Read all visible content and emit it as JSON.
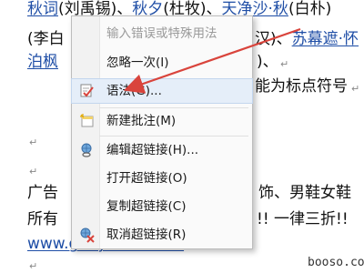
{
  "document": {
    "line1": {
      "seg1": "秋词",
      "seg2": "(刘禹锡)、",
      "seg3": "秋夕",
      "seg4": "(杜牧)、",
      "seg5": "天净沙·秋",
      "seg6": "(白朴)"
    },
    "line2": {
      "left": "(李白",
      "mid": "汉)、",
      "right": "苏幕遮·怀"
    },
    "line3": {
      "left": "泊枫",
      "right": ")、"
    },
    "line4": {
      "right": "能为标点符号"
    },
    "line5": {
      "left": "广告",
      "right": "饰、男鞋女鞋"
    },
    "line6": {
      "left": "所有",
      "right": "!! 一律三折!!"
    },
    "line7": {
      "url": "www.gouyuhan.com"
    },
    "para_mark": "↵"
  },
  "context_menu": {
    "items": [
      {
        "label": "输入错误或特殊用法",
        "icon": "none",
        "enabled": false
      },
      {
        "label": "忽略一次(I)",
        "icon": "none",
        "enabled": true
      },
      {
        "label": "语法(G)...",
        "icon": "grammar-check-icon",
        "enabled": true
      },
      {
        "label": "新建批注(M)",
        "icon": "new-comment-icon",
        "enabled": true
      },
      {
        "label": "编辑超链接(H)...",
        "icon": "edit-hyperlink-icon",
        "enabled": true
      },
      {
        "label": "打开超链接(O)",
        "icon": "none",
        "enabled": true
      },
      {
        "label": "复制超链接(C)",
        "icon": "none",
        "enabled": true
      },
      {
        "label": "取消超链接(R)",
        "icon": "remove-hyperlink-icon",
        "enabled": true
      }
    ]
  },
  "watermark": "booso.com",
  "colors": {
    "link": "#1f4ea6",
    "arrow": "#d9443c",
    "menu_bg": "#fafafa"
  }
}
